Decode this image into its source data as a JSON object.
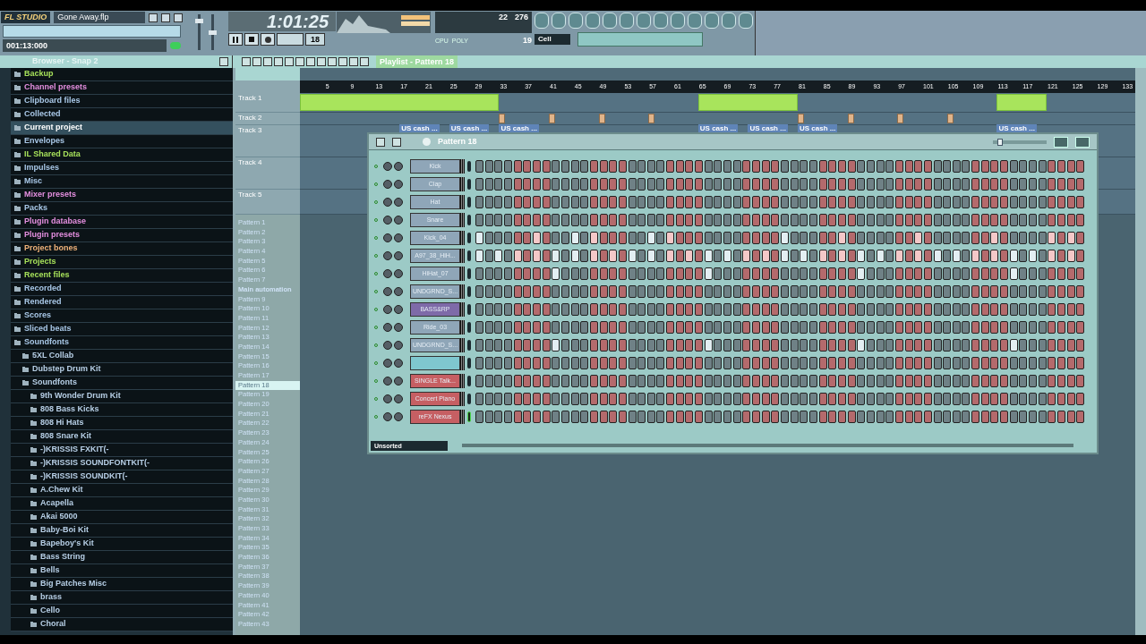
{
  "app": {
    "logo": "FL STUDIO",
    "title": "Gone Away.flp",
    "hint": "001:13:000",
    "time": "1:01:25",
    "cpu": "22",
    "poly_value": "276",
    "poly_count": "19",
    "cpu_label": "CPU",
    "poly_label": "POLY",
    "snap": "Cell",
    "pattern_number": "18"
  },
  "browser": {
    "title": "Browser - Snap 2",
    "items": [
      {
        "label": "Backup",
        "color": "#a6e05a",
        "selected": false
      },
      {
        "label": "Channel presets",
        "color": "#e58fe0",
        "selected": false
      },
      {
        "label": "Clipboard files",
        "color": "#a9c8e8",
        "selected": false
      },
      {
        "label": "Collected",
        "color": "#a9c8e8",
        "selected": false
      },
      {
        "label": "Current project",
        "selected": true
      },
      {
        "label": "Envelopes",
        "color": "#a9c8e8",
        "selected": false
      },
      {
        "label": "IL Shared Data",
        "color": "#a6e05a",
        "selected": false
      },
      {
        "label": "Impulses",
        "color": "#a9c8e8",
        "selected": false
      },
      {
        "label": "Misc",
        "color": "#a9c8e8",
        "selected": false
      },
      {
        "label": "Mixer presets",
        "color": "#e58fe0",
        "selected": false
      },
      {
        "label": "Packs",
        "color": "#a9c8e8",
        "selected": false
      },
      {
        "label": "Plugin database",
        "color": "#e58fe0",
        "selected": false
      },
      {
        "label": "Plugin presets",
        "color": "#e58fe0",
        "selected": false
      },
      {
        "label": "Project bones",
        "color": "#f0b27a",
        "selected": false
      },
      {
        "label": "Projects",
        "color": "#a6e05a",
        "selected": false
      },
      {
        "label": "Recent files",
        "color": "#a6e05a",
        "selected": false
      },
      {
        "label": "Recorded",
        "color": "#a9c8e8",
        "selected": false
      },
      {
        "label": "Rendered",
        "color": "#a9c8e8",
        "selected": false
      },
      {
        "label": "Scores",
        "color": "#a9c8e8",
        "selected": false
      },
      {
        "label": "Sliced beats",
        "color": "#a9c8e8",
        "selected": false
      },
      {
        "label": "Soundfonts",
        "color": "#a9c8e8",
        "selected": false,
        "children": [
          {
            "label": "5XL Collab",
            "selected": false
          },
          {
            "label": "Dubstep Drum Kit",
            "selected": false
          },
          {
            "label": "Soundfonts",
            "selected": false,
            "children": [
              {
                "label": "9th Wonder Drum Kit",
                "selected": false
              },
              {
                "label": "808 Bass Kicks",
                "selected": false
              },
              {
                "label": "808 Hi Hats",
                "selected": false
              },
              {
                "label": "808 Snare Kit",
                "selected": false
              },
              {
                "label": "-)KRISSIS FXKIT(-",
                "selected": false
              },
              {
                "label": "-)KRISSIS SOUNDFONTKIT(-",
                "selected": false
              },
              {
                "label": "-)KRISSIS SOUNDKIT(-",
                "selected": false
              },
              {
                "label": "A.Chew Kit",
                "selected": false
              },
              {
                "label": "Acapella",
                "selected": false
              },
              {
                "label": "Akai 5000",
                "selected": false
              },
              {
                "label": "Baby-Boi Kit",
                "selected": false
              },
              {
                "label": "Bapeboy's Kit",
                "selected": false
              },
              {
                "label": "Bass String",
                "selected": false
              },
              {
                "label": "Bells",
                "selected": false
              },
              {
                "label": "Big Patches Misc",
                "selected": false
              },
              {
                "label": "brass",
                "selected": false
              },
              {
                "label": "Cello",
                "selected": false
              },
              {
                "label": "Choral",
                "selected": false
              }
            ]
          }
        ]
      }
    ]
  },
  "playlist": {
    "title": "Playlist - Pattern 18",
    "ruler": [
      "5",
      "9",
      "13",
      "17",
      "21",
      "25",
      "29",
      "33",
      "37",
      "41",
      "45",
      "49",
      "53",
      "57",
      "61",
      "65",
      "69",
      "73",
      "77",
      "81",
      "85",
      "89",
      "93",
      "97",
      "101",
      "105",
      "109",
      "113",
      "117",
      "121",
      "125",
      "129",
      "133"
    ],
    "tracks": [
      {
        "name": "Track 1",
        "clips": [
          {
            "kind": "pattern"
          },
          {
            "kind": "pattern"
          },
          {
            "kind": "pattern"
          }
        ]
      },
      {
        "name": "Track 2",
        "clips": [
          {
            "kind": "sample"
          },
          {
            "kind": "sample"
          },
          {
            "kind": "sample"
          },
          {
            "kind": "sample"
          },
          {
            "kind": "sample"
          },
          {
            "kind": "sample"
          },
          {
            "kind": "sample"
          },
          {
            "kind": "sample"
          }
        ]
      },
      {
        "name": "Track 3",
        "clips": [
          {
            "kind": "audio",
            "label": "US cash ..."
          },
          {
            "kind": "audio",
            "label": "US cash ..."
          },
          {
            "kind": "audio",
            "label": "US cash ..."
          },
          {
            "kind": "audio",
            "label": "US cash ..."
          },
          {
            "kind": "audio",
            "label": "US cash ..."
          },
          {
            "kind": "audio",
            "label": "US cash ..."
          },
          {
            "kind": "audio",
            "label": "US cash ..."
          }
        ]
      },
      {
        "name": "Track 4"
      },
      {
        "name": "Track 5"
      }
    ],
    "patterns": [
      {
        "name": "Pattern 1",
        "selected": false
      },
      {
        "name": "Pattern 2",
        "selected": false
      },
      {
        "name": "Pattern 3",
        "selected": false
      },
      {
        "name": "Pattern 4",
        "selected": false
      },
      {
        "name": "Pattern 5",
        "selected": false
      },
      {
        "name": "Pattern 6",
        "selected": false
      },
      {
        "name": "Pattern 7",
        "selected": false
      },
      {
        "name": "Main automation",
        "selected": false
      },
      {
        "name": "Pattern 9",
        "selected": false
      },
      {
        "name": "Pattern 10",
        "selected": false
      },
      {
        "name": "Pattern 11",
        "selected": false
      },
      {
        "name": "Pattern 12",
        "selected": false
      },
      {
        "name": "Pattern 13",
        "selected": false
      },
      {
        "name": "Pattern 14",
        "selected": false
      },
      {
        "name": "Pattern 15",
        "selected": false
      },
      {
        "name": "Pattern 16",
        "selected": false
      },
      {
        "name": "Pattern 17",
        "selected": false
      },
      {
        "name": "Pattern 18",
        "selected": true
      },
      {
        "name": "Pattern 19",
        "selected": false
      },
      {
        "name": "Pattern 20",
        "selected": false
      },
      {
        "name": "Pattern 21",
        "selected": false
      },
      {
        "name": "Pattern 22",
        "selected": false
      },
      {
        "name": "Pattern 23",
        "selected": false
      },
      {
        "name": "Pattern 24",
        "selected": false
      },
      {
        "name": "Pattern 25",
        "selected": false
      },
      {
        "name": "Pattern 26",
        "selected": false
      },
      {
        "name": "Pattern 27",
        "selected": false
      },
      {
        "name": "Pattern 28",
        "selected": false
      },
      {
        "name": "Pattern 29",
        "selected": false
      },
      {
        "name": "Pattern 30",
        "selected": false
      },
      {
        "name": "Pattern 31",
        "selected": false
      },
      {
        "name": "Pattern 32",
        "selected": false
      },
      {
        "name": "Pattern 33",
        "selected": false
      },
      {
        "name": "Pattern 34",
        "selected": false
      },
      {
        "name": "Pattern 35",
        "selected": false
      },
      {
        "name": "Pattern 36",
        "selected": false
      },
      {
        "name": "Pattern 37",
        "selected": false
      },
      {
        "name": "Pattern 38",
        "selected": false
      },
      {
        "name": "Pattern 39",
        "selected": false
      },
      {
        "name": "Pattern 40",
        "selected": false
      },
      {
        "name": "Pattern 41",
        "selected": false
      },
      {
        "name": "Pattern 42",
        "selected": false
      },
      {
        "name": "Pattern 43",
        "selected": false
      }
    ]
  },
  "mixer": {
    "master_volume": {
      "level": 0.85
    },
    "master_pitch": {
      "level": 0.5
    }
  },
  "step_sequencer": {
    "title": "Pattern 18",
    "filter": "Unsorted",
    "swing": {
      "level": 0.1
    },
    "channels": [
      {
        "name": "Kick",
        "color": "#8fa6b8",
        "selected": false,
        "steps": [
          false,
          false,
          false,
          false,
          false,
          false,
          false,
          false,
          false,
          false,
          false,
          false,
          false,
          false,
          false,
          false,
          false,
          false,
          false,
          false,
          false,
          false,
          false,
          false,
          false,
          false,
          false,
          false,
          false,
          false,
          false,
          false,
          false,
          false,
          false,
          false,
          false,
          false,
          false,
          false,
          false,
          false,
          false,
          false,
          false,
          false,
          false,
          false,
          false,
          false,
          false,
          false,
          false,
          false,
          false,
          false,
          false,
          false,
          false,
          false,
          false,
          false,
          false,
          false
        ]
      },
      {
        "name": "Clap",
        "color": "#8fa6b8",
        "selected": false,
        "steps": [
          false,
          false,
          false,
          false,
          false,
          false,
          false,
          false,
          false,
          false,
          false,
          false,
          false,
          false,
          false,
          false,
          false,
          false,
          false,
          false,
          false,
          false,
          false,
          false,
          false,
          false,
          false,
          false,
          false,
          false,
          false,
          false,
          false,
          false,
          false,
          false,
          false,
          false,
          false,
          false,
          false,
          false,
          false,
          false,
          false,
          false,
          false,
          false,
          false,
          false,
          false,
          false,
          false,
          false,
          false,
          false,
          false,
          false,
          false,
          false,
          false,
          false,
          false,
          false
        ]
      },
      {
        "name": "Hat",
        "color": "#8fa6b8",
        "selected": false,
        "steps": [
          false,
          false,
          false,
          false,
          false,
          false,
          false,
          false,
          false,
          false,
          false,
          false,
          false,
          false,
          false,
          false,
          false,
          false,
          false,
          false,
          false,
          false,
          false,
          false,
          false,
          false,
          false,
          false,
          false,
          false,
          false,
          false,
          false,
          false,
          false,
          false,
          false,
          false,
          false,
          false,
          false,
          false,
          false,
          false,
          false,
          false,
          false,
          false,
          false,
          false,
          false,
          false,
          false,
          false,
          false,
          false,
          false,
          false,
          false,
          false,
          false,
          false,
          false,
          false
        ]
      },
      {
        "name": "Snare",
        "color": "#8fa6b8",
        "selected": false,
        "steps": [
          false,
          false,
          false,
          false,
          false,
          false,
          false,
          false,
          false,
          false,
          false,
          false,
          false,
          false,
          false,
          false,
          false,
          false,
          false,
          false,
          false,
          false,
          false,
          false,
          false,
          false,
          false,
          false,
          false,
          false,
          false,
          false,
          false,
          false,
          false,
          false,
          false,
          false,
          false,
          false,
          false,
          false,
          false,
          false,
          false,
          false,
          false,
          false,
          false,
          false,
          false,
          false,
          false,
          false,
          false,
          false,
          false,
          false,
          false,
          false,
          false,
          false,
          false,
          false
        ]
      },
      {
        "name": "Kick_04",
        "color": "#8fa6b8",
        "selected": false,
        "steps": [
          true,
          false,
          false,
          false,
          false,
          false,
          true,
          false,
          false,
          false,
          true,
          false,
          true,
          false,
          false,
          false,
          false,
          false,
          true,
          false,
          true,
          false,
          false,
          false,
          false,
          false,
          false,
          false,
          false,
          false,
          false,
          false,
          true,
          false,
          false,
          false,
          false,
          false,
          true,
          false,
          false,
          false,
          false,
          false,
          false,
          false,
          true,
          false,
          false,
          false,
          false,
          false,
          false,
          false,
          true,
          false,
          false,
          false,
          false,
          false,
          true,
          false,
          true,
          false
        ]
      },
      {
        "name": "A97_38_HiH...",
        "color": "#8fa6b8",
        "selected": false,
        "steps": [
          true,
          false,
          true,
          false,
          true,
          false,
          true,
          false,
          true,
          false,
          true,
          false,
          true,
          false,
          true,
          false,
          true,
          false,
          true,
          false,
          true,
          false,
          true,
          false,
          true,
          false,
          true,
          false,
          true,
          false,
          true,
          false,
          true,
          false,
          true,
          false,
          true,
          false,
          true,
          false,
          true,
          false,
          true,
          false,
          true,
          false,
          true,
          false,
          true,
          false,
          true,
          false,
          true,
          false,
          true,
          false,
          true,
          false,
          true,
          false,
          true,
          false,
          true,
          false
        ]
      },
      {
        "name": "HiHat_07",
        "color": "#8fa6b8",
        "selected": false,
        "steps": [
          false,
          false,
          false,
          false,
          false,
          false,
          false,
          false,
          true,
          false,
          false,
          false,
          false,
          false,
          false,
          false,
          false,
          false,
          false,
          false,
          false,
          false,
          false,
          false,
          true,
          false,
          false,
          false,
          false,
          false,
          false,
          false,
          false,
          false,
          false,
          false,
          false,
          false,
          false,
          false,
          true,
          false,
          false,
          false,
          false,
          false,
          false,
          false,
          false,
          false,
          false,
          false,
          false,
          false,
          false,
          false,
          true,
          false,
          false,
          false,
          false,
          false,
          false,
          false
        ]
      },
      {
        "name": "UNDGRND_S...",
        "color": "#8fa6b8",
        "selected": false,
        "steps": [
          false,
          false,
          false,
          false,
          false,
          false,
          false,
          false,
          false,
          false,
          false,
          false,
          false,
          false,
          false,
          false,
          false,
          false,
          false,
          false,
          false,
          false,
          false,
          false,
          false,
          false,
          false,
          false,
          false,
          false,
          false,
          false,
          false,
          false,
          false,
          false,
          false,
          false,
          false,
          false,
          false,
          false,
          false,
          false,
          false,
          false,
          false,
          false,
          false,
          false,
          false,
          false,
          false,
          false,
          false,
          false,
          false,
          false,
          false,
          false,
          false,
          false,
          false,
          false
        ]
      },
      {
        "name": "BASS&RP",
        "color": "#7e6aa8",
        "selected": false,
        "steps": [
          false,
          false,
          false,
          false,
          false,
          false,
          false,
          false,
          false,
          false,
          false,
          false,
          false,
          false,
          false,
          false,
          false,
          false,
          false,
          false,
          false,
          false,
          false,
          false,
          false,
          false,
          false,
          false,
          false,
          false,
          false,
          false,
          false,
          false,
          false,
          false,
          false,
          false,
          false,
          false,
          false,
          false,
          false,
          false,
          false,
          false,
          false,
          false,
          false,
          false,
          false,
          false,
          false,
          false,
          false,
          false,
          false,
          false,
          false,
          false,
          false,
          false,
          false,
          false
        ]
      },
      {
        "name": "Ride_03",
        "color": "#8fa6b8",
        "selected": false,
        "steps": [
          false,
          false,
          false,
          false,
          false,
          false,
          false,
          false,
          false,
          false,
          false,
          false,
          false,
          false,
          false,
          false,
          false,
          false,
          false,
          false,
          false,
          false,
          false,
          false,
          false,
          false,
          false,
          false,
          false,
          false,
          false,
          false,
          false,
          false,
          false,
          false,
          false,
          false,
          false,
          false,
          false,
          false,
          false,
          false,
          false,
          false,
          false,
          false,
          false,
          false,
          false,
          false,
          false,
          false,
          false,
          false,
          false,
          false,
          false,
          false,
          false,
          false,
          false,
          false
        ]
      },
      {
        "name": "UNDGRND_S...",
        "color": "#8fa6b8",
        "selected": false,
        "steps": [
          false,
          false,
          false,
          false,
          false,
          false,
          false,
          false,
          true,
          false,
          false,
          false,
          false,
          false,
          false,
          false,
          false,
          false,
          false,
          false,
          false,
          false,
          false,
          false,
          true,
          false,
          false,
          false,
          false,
          false,
          false,
          false,
          false,
          false,
          false,
          false,
          false,
          false,
          false,
          false,
          true,
          false,
          false,
          false,
          false,
          false,
          false,
          false,
          false,
          false,
          false,
          false,
          false,
          false,
          false,
          false,
          true,
          false,
          false,
          false,
          false,
          false,
          false,
          false
        ]
      },
      {
        "color": "#7fc7cf",
        "selected": false,
        "steps": [
          false,
          false,
          false,
          false,
          false,
          false,
          false,
          false,
          false,
          false,
          false,
          false,
          false,
          false,
          false,
          false,
          false,
          false,
          false,
          false,
          false,
          false,
          false,
          false,
          false,
          false,
          false,
          false,
          false,
          false,
          false,
          false,
          false,
          false,
          false,
          false,
          false,
          false,
          false,
          false,
          false,
          false,
          false,
          false,
          false,
          false,
          false,
          false,
          false,
          false,
          false,
          false,
          false,
          false,
          false,
          false,
          false,
          false,
          false,
          false,
          false,
          false,
          false,
          false
        ]
      },
      {
        "name": "SINGLE Talk...",
        "color": "#c65f63",
        "selected": false,
        "steps": [
          false,
          false,
          false,
          false,
          false,
          false,
          false,
          false,
          false,
          false,
          false,
          false,
          false,
          false,
          false,
          false,
          false,
          false,
          false,
          false,
          false,
          false,
          false,
          false,
          false,
          false,
          false,
          false,
          false,
          false,
          false,
          false,
          false,
          false,
          false,
          false,
          false,
          false,
          false,
          false,
          false,
          false,
          false,
          false,
          false,
          false,
          false,
          false,
          false,
          false,
          false,
          false,
          false,
          false,
          false,
          false,
          false,
          false,
          false,
          false,
          false,
          false,
          false,
          false
        ]
      },
      {
        "name": "Concert Piano",
        "color": "#c65f63",
        "selected": false,
        "steps": [
          false,
          false,
          false,
          false,
          false,
          false,
          false,
          false,
          false,
          false,
          false,
          false,
          false,
          false,
          false,
          false,
          false,
          false,
          false,
          false,
          false,
          false,
          false,
          false,
          false,
          false,
          false,
          false,
          false,
          false,
          false,
          false,
          false,
          false,
          false,
          false,
          false,
          false,
          false,
          false,
          false,
          false,
          false,
          false,
          false,
          false,
          false,
          false,
          false,
          false,
          false,
          false,
          false,
          false,
          false,
          false,
          false,
          false,
          false,
          false,
          false,
          false,
          false,
          false
        ]
      },
      {
        "name": "reFX Nexus",
        "color": "#c65f63",
        "selected": true,
        "steps": [
          false,
          false,
          false,
          false,
          false,
          false,
          false,
          false,
          false,
          false,
          false,
          false,
          false,
          false,
          false,
          false,
          false,
          false,
          false,
          false,
          false,
          false,
          false,
          false,
          false,
          false,
          false,
          false,
          false,
          false,
          false,
          false,
          false,
          false,
          false,
          false,
          false,
          false,
          false,
          false,
          false,
          false,
          false,
          false,
          false,
          false,
          false,
          false,
          false,
          false,
          false,
          false,
          false,
          false,
          false,
          false,
          false,
          false,
          false,
          false,
          false,
          false,
          false,
          false
        ]
      }
    ]
  }
}
